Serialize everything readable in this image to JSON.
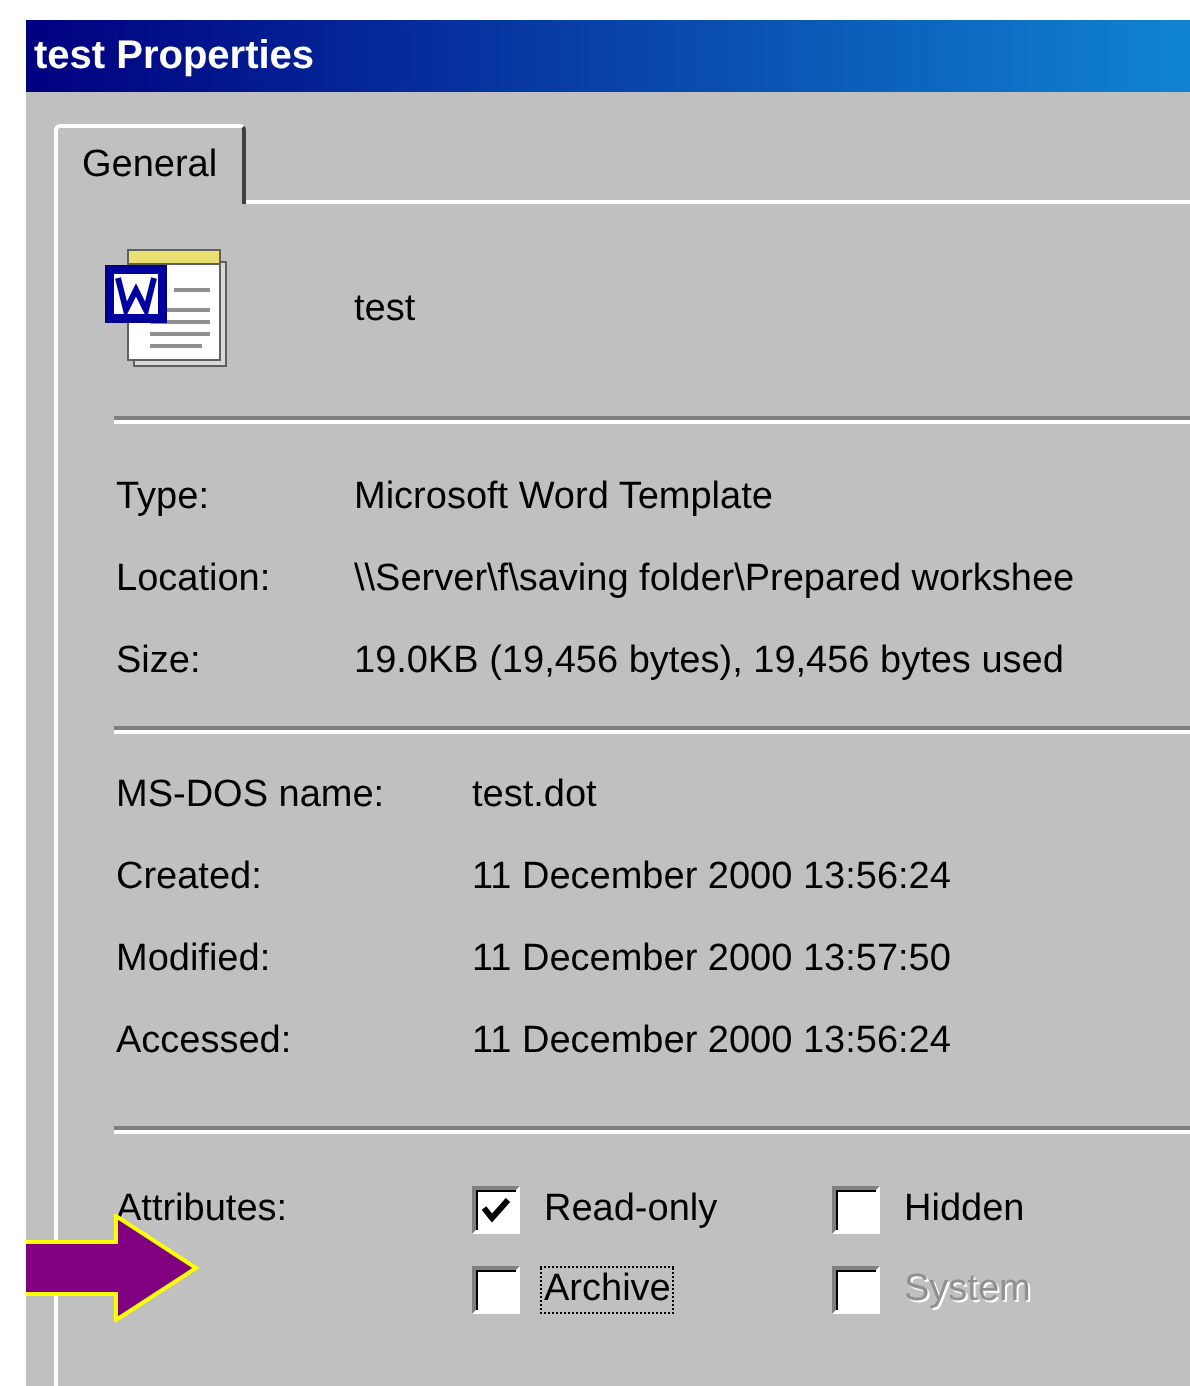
{
  "window": {
    "title": "test Properties"
  },
  "tabs": [
    {
      "label": "General",
      "selected": true
    }
  ],
  "file": {
    "name": "test"
  },
  "details": [
    {
      "label": "Type:",
      "value": "Microsoft Word Template"
    },
    {
      "label": "Location:",
      "value": "\\\\Server\\f\\saving folder\\Prepared workshee"
    },
    {
      "label": "Size:",
      "value": "19.0KB (19,456 bytes), 19,456 bytes used"
    }
  ],
  "dates": [
    {
      "label": "MS-DOS name:",
      "value": "test.dot"
    },
    {
      "label": "Created:",
      "value": "11 December 2000 13:56:24"
    },
    {
      "label": "Modified:",
      "value": "11 December 2000 13:57:50"
    },
    {
      "label": "Accessed:",
      "value": "11 December 2000 13:56:24"
    }
  ],
  "attributes": {
    "label": "Attributes:",
    "options": [
      {
        "label": "Read-only",
        "checked": true,
        "focused": false,
        "disabled": false
      },
      {
        "label": "Hidden",
        "checked": false,
        "focused": false,
        "disabled": false
      },
      {
        "label": "Archive",
        "checked": false,
        "focused": true,
        "disabled": false
      },
      {
        "label": "System",
        "checked": false,
        "focused": false,
        "disabled": true
      }
    ]
  }
}
